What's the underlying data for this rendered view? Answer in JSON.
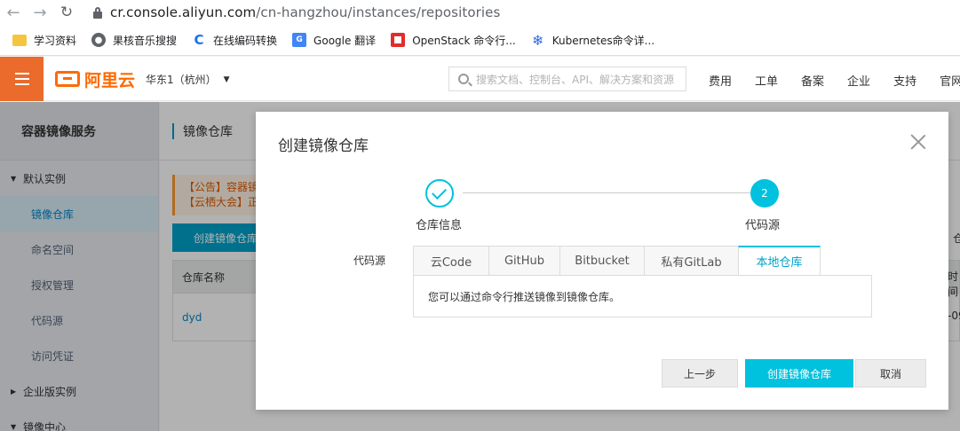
{
  "browser": {
    "url_host": "cr.console.aliyun.com",
    "url_path": "/cn-hangzhou/instances/repositories",
    "bookmarks": [
      {
        "label": "学习资料",
        "icon": "folder-icon"
      },
      {
        "label": "果核音乐搜搜",
        "icon": "globe-icon"
      },
      {
        "label": "在线编码转换",
        "icon": "c-logo-icon"
      },
      {
        "label": "Google 翻译",
        "icon": "google-translate-icon"
      },
      {
        "label": "OpenStack 命令行...",
        "icon": "openstack-icon"
      },
      {
        "label": "Kubernetes命令详...",
        "icon": "kubernetes-icon"
      }
    ]
  },
  "topbar": {
    "logo": "阿里云",
    "region": "华东1（杭州）",
    "search_placeholder": "搜索文档、控制台、API、解决方案和资源",
    "nav": [
      "费用",
      "工单",
      "备案",
      "企业",
      "支持",
      "官网"
    ]
  },
  "sidebar": {
    "title": "容器镜像服务",
    "group_default": "默认实例",
    "items": [
      "镜像仓库",
      "命名空间",
      "授权管理",
      "代码源",
      "访问凭证"
    ],
    "group_enterprise": "企业版实例",
    "group_center": "镜像中心"
  },
  "main": {
    "header": "镜像仓库",
    "notice_line1": "【公告】容器镜",
    "notice_line2": "【云栖大会】正",
    "create_button": "创建镜像仓库",
    "col_name": "仓库名称",
    "row_name": "dyd",
    "right_frag1": "仓",
    "right_frag2": "时间",
    "right_frag3": "-09"
  },
  "modal": {
    "title": "创建镜像仓库",
    "step1_label": "仓库信息",
    "step2_number": "2",
    "step2_label": "代码源",
    "source_label": "代码源",
    "tabs": [
      "云Code",
      "GitHub",
      "Bitbucket",
      "私有GitLab",
      "本地仓库"
    ],
    "active_tab": "本地仓库",
    "panel_text": "您可以通过命令行推送镜像到镜像仓库。",
    "prev_button": "上一步",
    "create_button": "创建镜像仓库",
    "cancel_button": "取消"
  },
  "colors": {
    "accent": "#00c1de",
    "brand_orange": "#ff6a00",
    "link_blue": "#0088cc"
  }
}
